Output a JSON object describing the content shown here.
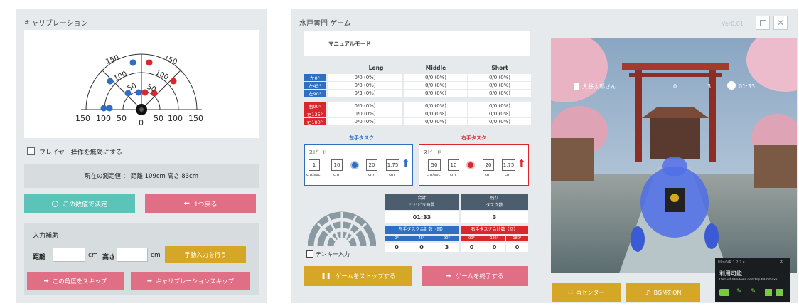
{
  "left": {
    "title": "キャリブレーション",
    "arc_labels_outer": [
      "150",
      "150"
    ],
    "arc_labels_mid": [
      "100",
      "100"
    ],
    "arc_labels_inner": [
      "50",
      "50"
    ],
    "axis_labels": [
      "150",
      "100",
      "50",
      "0",
      "50",
      "100",
      "150"
    ],
    "marker_letters": [
      "L",
      "R"
    ],
    "disable_player_label": "プレイヤー操作を無効にする",
    "measurement_text": "現在の測定値 ： 距離 109cm 高さ 83cm",
    "confirm_label": "この数値で決定",
    "back_label": "1つ戻る",
    "input_assist_title": "入力補助",
    "distance_label": "距離",
    "height_label": "高さ",
    "unit_cm": "cm",
    "manual_input_label": "手動入力を行う",
    "skip_angle_label": "この角度をスキップ",
    "skip_calib_label": "キャリブレーションスキップ"
  },
  "right": {
    "title": "水戸黄門 ゲーム",
    "version": "Ver0.01",
    "mode": "マニュアルモード",
    "columns": [
      "Long",
      "Middle",
      "Short"
    ],
    "left_rows": [
      {
        "label": "左0°",
        "values": [
          "0/0 (0%)",
          "0/0 (0%)",
          "0/0 (0%)"
        ]
      },
      {
        "label": "左45°",
        "values": [
          "0/0 (0%)",
          "0/0 (0%)",
          "0/0 (0%)"
        ]
      },
      {
        "label": "左90°",
        "values": [
          "0/3 (0%)",
          "0/0 (0%)",
          "0/0 (0%)"
        ]
      }
    ],
    "right_rows": [
      {
        "label": "右90°",
        "values": [
          "0/0 (0%)",
          "0/0 (0%)",
          "0/0 (0%)"
        ]
      },
      {
        "label": "右135°",
        "values": [
          "0/0 (0%)",
          "0/0 (0%)",
          "0/0 (0%)"
        ]
      },
      {
        "label": "右180°",
        "values": [
          "0/0 (0%)",
          "0/0 (0%)",
          "0/0 (0%)"
        ]
      }
    ],
    "left_task_title": "左手タスク",
    "right_task_title": "右手タスク",
    "speed_label": "スピード",
    "left_task": {
      "speed": "1",
      "unit_speed": "cm/sec",
      "v1": "10",
      "u1": "cm",
      "v2": "20",
      "u2": "cm",
      "v3": "1.75",
      "u3": "cm"
    },
    "right_task": {
      "speed": "50",
      "unit_speed": "cm/sec",
      "v1": "10",
      "u1": "cm",
      "v2": "20",
      "u2": "cm",
      "v3": "1.75",
      "u3": "cm"
    },
    "total_rehab_label": "合計\nリハビリ時間",
    "total_rehab_l1": "合計",
    "total_rehab_l2": "リハビリ時間",
    "remaining_l1": "残り",
    "remaining_l2": "タスク数",
    "rehab_time": "01:33",
    "remaining_tasks": "3",
    "left_total_label": "左手タスク合計数（回）",
    "right_total_label": "右手タスク合計数（回）",
    "left_angles": [
      "0°",
      "45°",
      "90°"
    ],
    "right_angles": [
      "90°",
      "135°",
      "180°"
    ],
    "left_counts": [
      "0",
      "0",
      "3"
    ],
    "right_counts": [
      "0",
      "0",
      "0"
    ],
    "tenkey_label": "テンキー入力",
    "stop_label": "ゲームをストップする",
    "end_label": "ゲームを終了する",
    "recenter_label": "再センター",
    "bgm_label": "BGMをON",
    "hud": {
      "player": "大谷太郎さん",
      "count1": "0",
      "count2": "3",
      "time": "01:33"
    },
    "popup": {
      "header": "UltraVR 1.2.7 ▾",
      "status": "利用可能",
      "desc": "Default Windows desktop 64-bit exe"
    }
  },
  "colors": {
    "teal": "#5cc3b8",
    "pink": "#e06f86",
    "gold": "#d6a626",
    "blue": "#2f6fc2",
    "red": "#d9272e",
    "navy": "#4c5d6e"
  }
}
